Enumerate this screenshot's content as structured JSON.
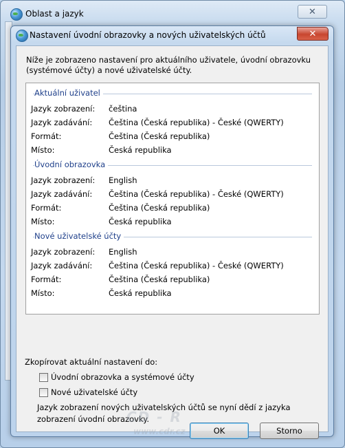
{
  "outer_window": {
    "title": "Oblast a jazyk",
    "close_glyph": "✕"
  },
  "dialog": {
    "title": "Nastavení úvodní obrazovky a nových uživatelských účtů",
    "close_glyph": "✕",
    "intro": "Níže je zobrazeno nastavení pro aktuálního uživatele, úvodní obrazovku (systémové účty) a nové uživatelské účty.",
    "groups": [
      {
        "title": "Aktuální uživatel",
        "rows": [
          {
            "label": "Jazyk zobrazení:",
            "value": "čeština"
          },
          {
            "label": "Jazyk zadávání:",
            "value": "Čeština (Česká republika) - České (QWERTY)"
          },
          {
            "label": "Formát:",
            "value": "Čeština (Česká republika)"
          },
          {
            "label": "Místo:",
            "value": "Česká republika"
          }
        ]
      },
      {
        "title": "Úvodní obrazovka",
        "rows": [
          {
            "label": "Jazyk zobrazení:",
            "value": "English"
          },
          {
            "label": "Jazyk zadávání:",
            "value": "Čeština (Česká republika) - České (QWERTY)"
          },
          {
            "label": "Formát:",
            "value": "Čeština (Česká republika)"
          },
          {
            "label": "Místo:",
            "value": "Česká republika"
          }
        ]
      },
      {
        "title": "Nové uživatelské účty",
        "rows": [
          {
            "label": "Jazyk zobrazení:",
            "value": "English"
          },
          {
            "label": "Jazyk zadávání:",
            "value": "Čeština (Česká republika) - České (QWERTY)"
          },
          {
            "label": "Formát:",
            "value": "Čeština (Česká republika)"
          },
          {
            "label": "Místo:",
            "value": "Česká republika"
          }
        ]
      }
    ],
    "copy_label": "Zkopírovat aktuální nastavení do:",
    "checkboxes": [
      {
        "label": "Úvodní obrazovka a systémové účty",
        "checked": false
      },
      {
        "label": "Nové uživatelské účty",
        "checked": false
      }
    ],
    "note": "Jazyk zobrazení nových uživatelských účtů se nyní dědí z jazyka zobrazení úvodní obrazovky.",
    "ok_label": "OK",
    "cancel_label": "Storno"
  },
  "watermark": {
    "line1": "CD - R",
    "line2": "www.cdr.cz"
  }
}
